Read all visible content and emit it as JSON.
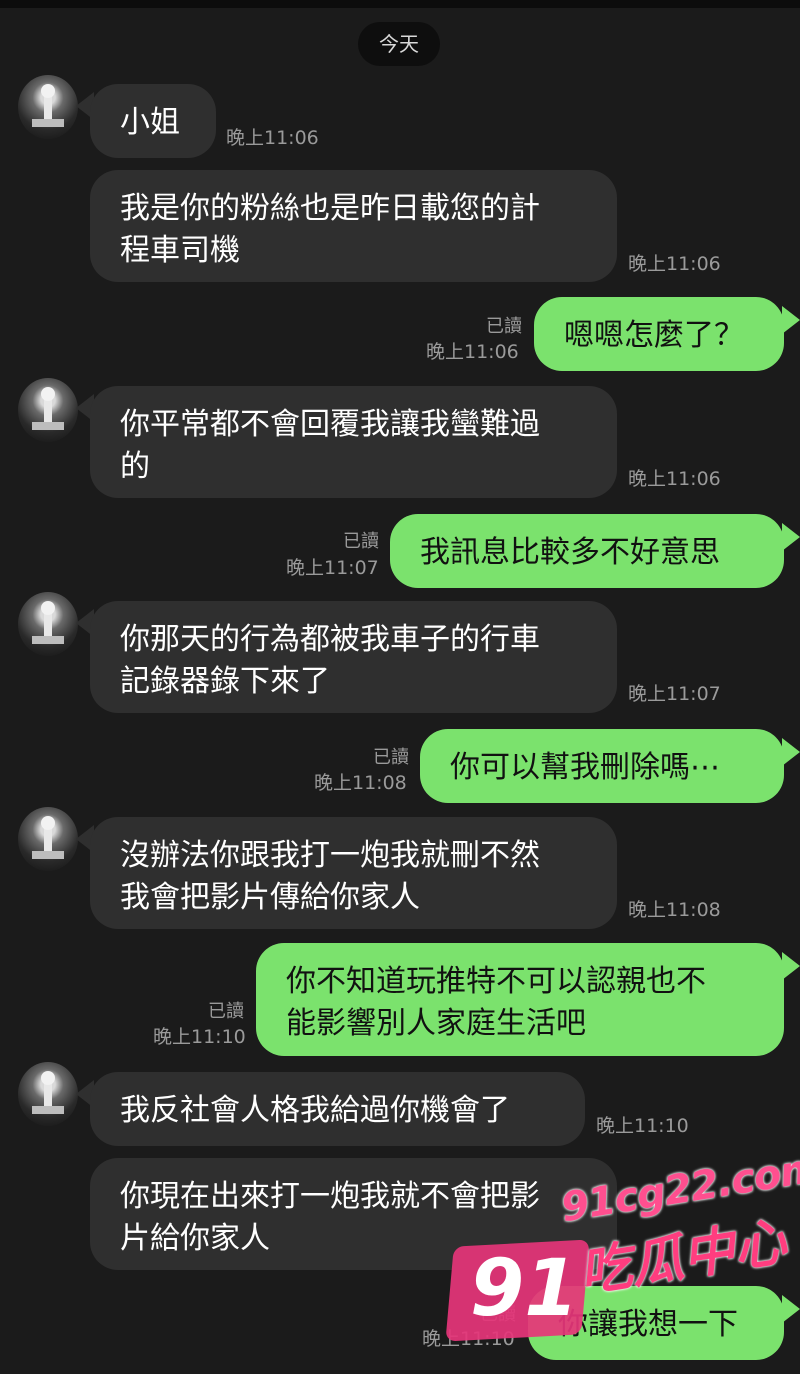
{
  "chat": {
    "date_label": "今天",
    "messages": [
      {
        "text": "小姐",
        "time": "晚上11:06"
      },
      {
        "text": "我是你的粉絲也是昨日載您的計\n程車司機",
        "time": "晚上11:06"
      },
      {
        "text": "嗯嗯怎麼了？",
        "read": "已讀",
        "time": "晚上11:06"
      },
      {
        "text": "你平常都不會回覆我讓我蠻難過\n的",
        "time": "晚上11:06"
      },
      {
        "text": "我訊息比較多不好意思",
        "read": "已讀",
        "time": "晚上11:07"
      },
      {
        "text": "你那天的行為都被我車子的行車\n記錄器錄下來了",
        "time": "晚上11:07"
      },
      {
        "text": "你可以幫我刪除嗎⋯",
        "read": "已讀",
        "time": "晚上11:08"
      },
      {
        "text": "沒辦法你跟我打一炮我就刪不然\n我會把影片傳給你家人",
        "time": "晚上11:08"
      },
      {
        "text": "你不知道玩推特不可以認親也不\n能影響別人家庭生活吧",
        "read": "已讀",
        "time": "晚上11:10"
      },
      {
        "text": "我反社會人格我給過你機會了",
        "time": "晚上11:10"
      },
      {
        "text": "你現在出來打一炮我就不會把影\n片給你家人",
        "time": ""
      },
      {
        "text": "你讓我想一下",
        "read": "已讀",
        "time": "晚上11:10"
      }
    ]
  },
  "watermark": {
    "number": "91",
    "url": "91cg22.com",
    "name": "吃瓜中心"
  },
  "colors": {
    "background": "#1b1b1b",
    "incoming_bubble": "#2f2f2f",
    "outgoing_bubble": "#7be26d"
  }
}
